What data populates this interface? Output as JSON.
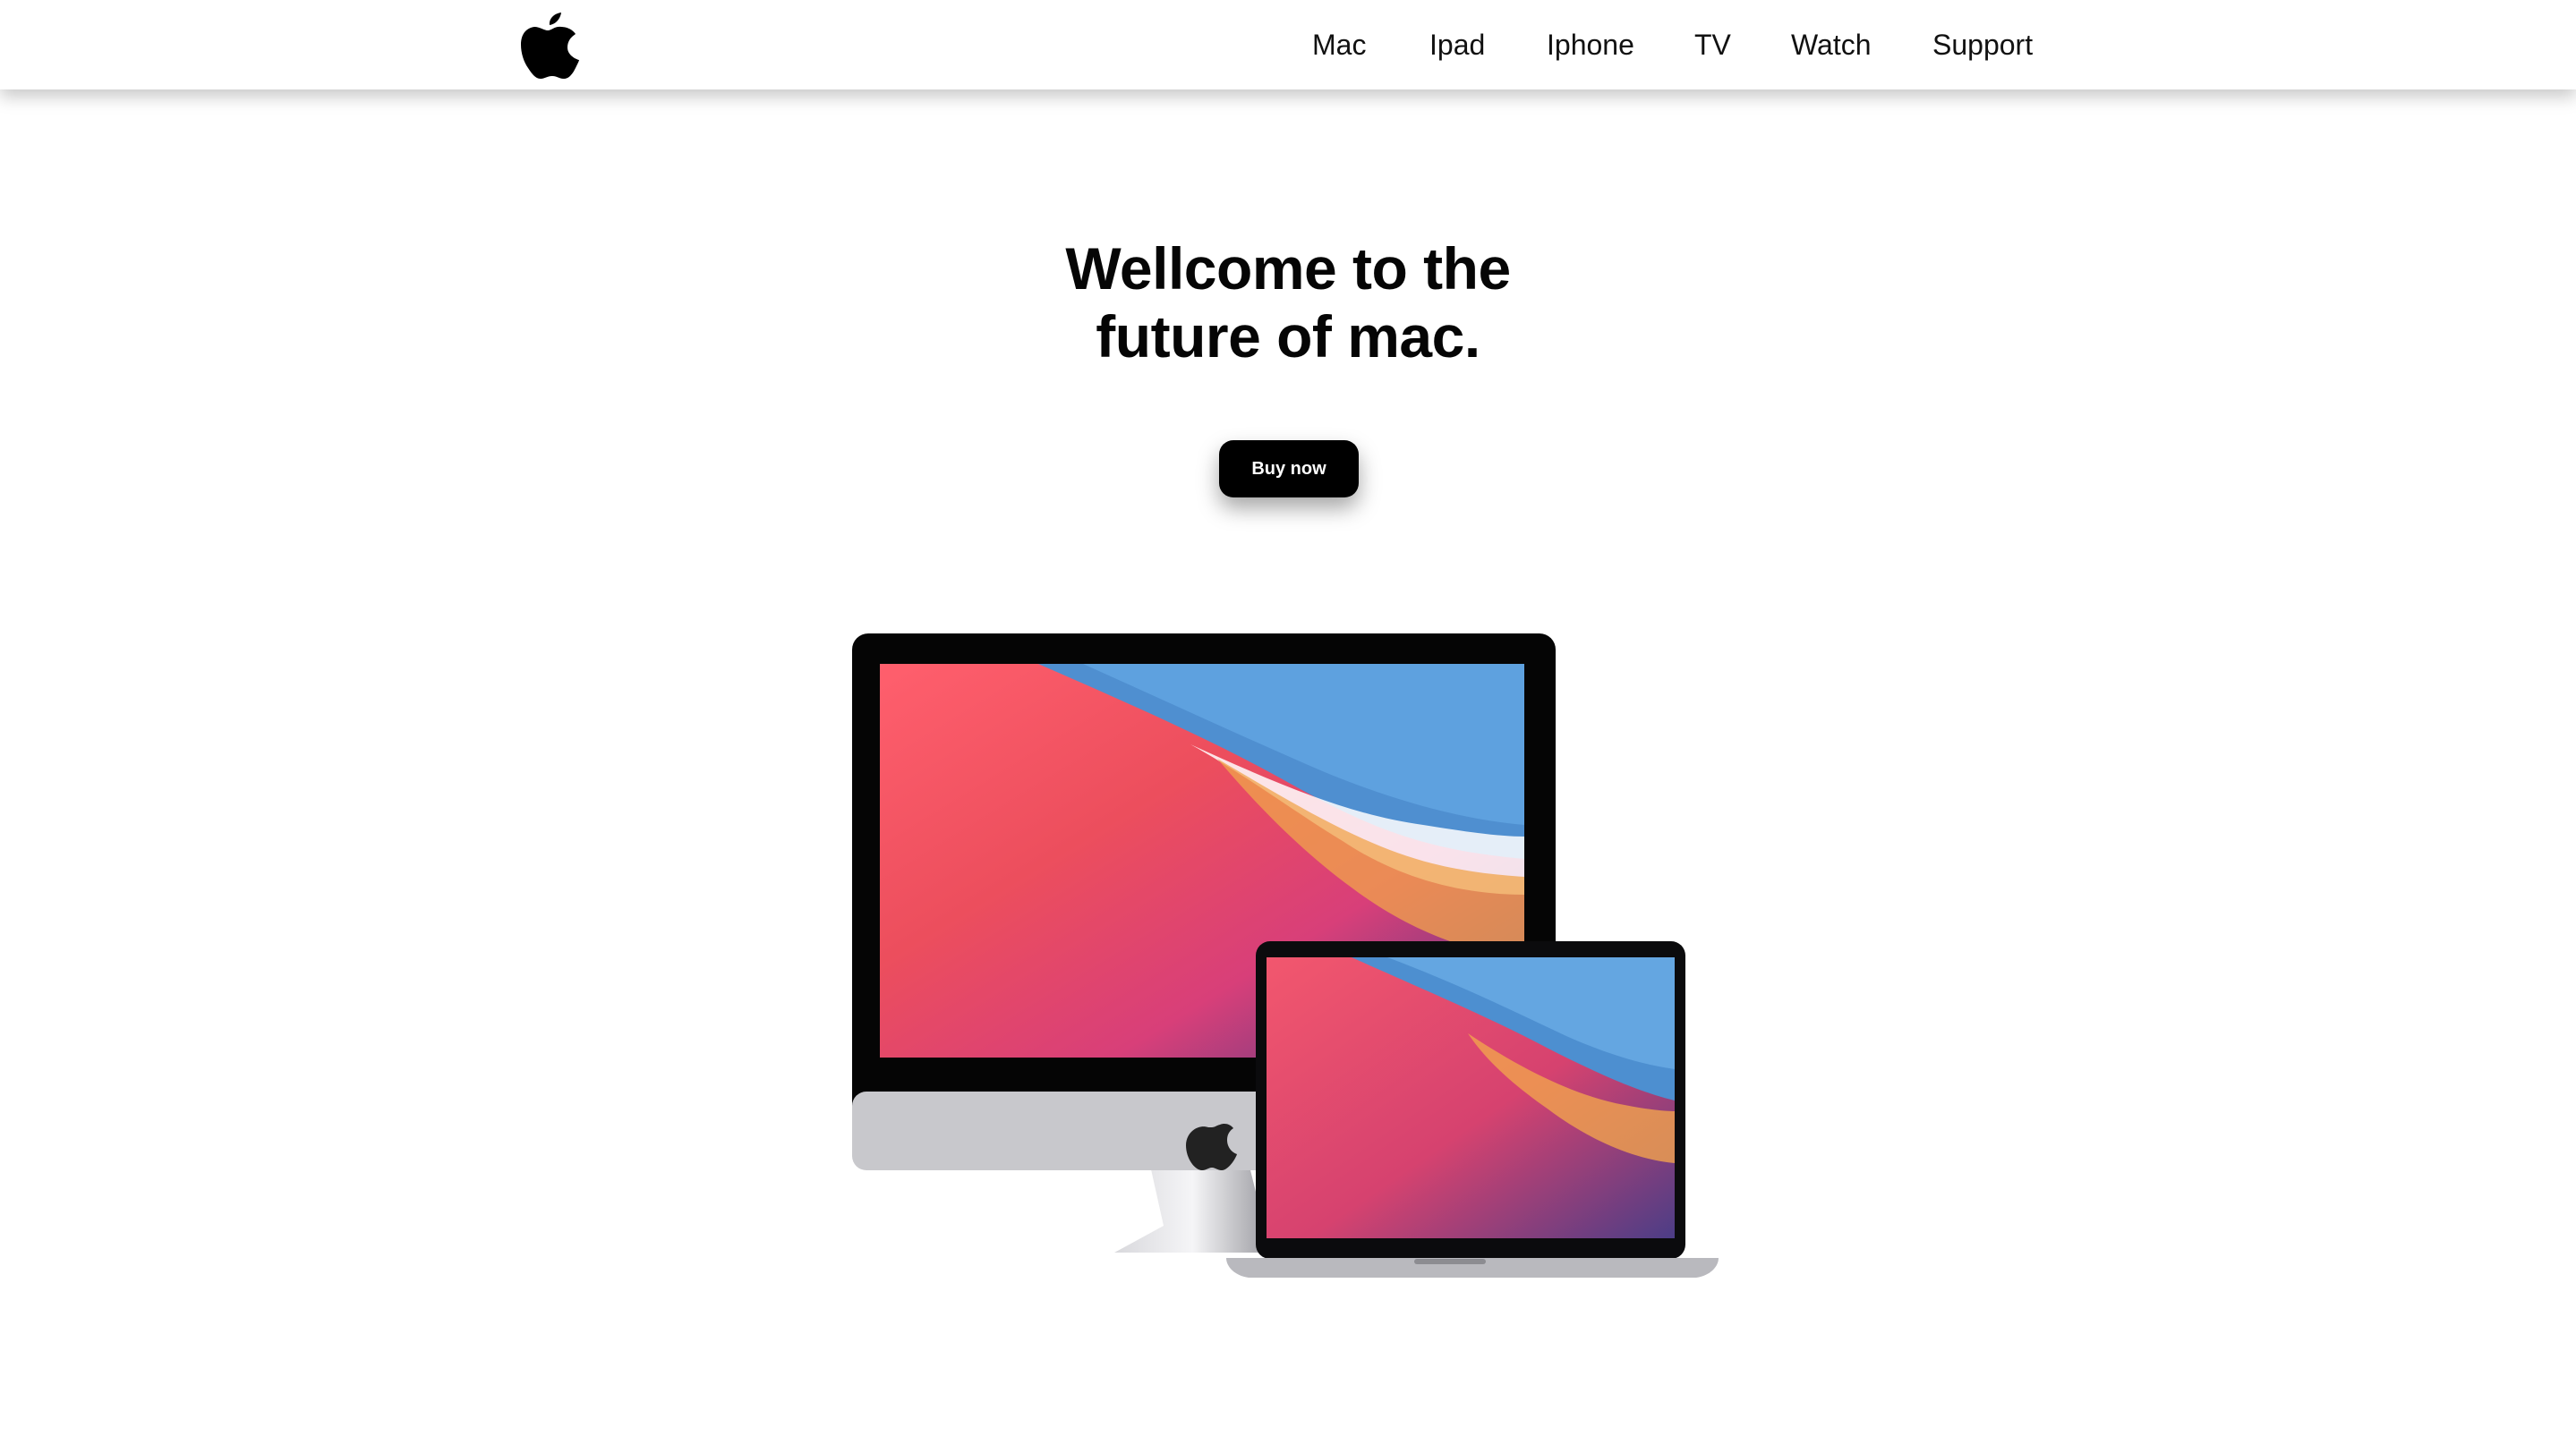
{
  "brand": {
    "logo_icon": "apple-logo-icon"
  },
  "nav": {
    "items": [
      {
        "label": "Mac"
      },
      {
        "label": "Ipad"
      },
      {
        "label": "Iphone"
      },
      {
        "label": "TV"
      },
      {
        "label": "Watch"
      },
      {
        "label": "Support"
      }
    ]
  },
  "hero": {
    "title_line1": "Wellcome to the",
    "title_line2": "future of mac.",
    "cta_label": "Buy now",
    "image_icon": "imac-and-macbook-illustration"
  },
  "colors": {
    "background": "#ffffff",
    "text": "#000000",
    "button_bg": "#000000",
    "button_text": "#ffffff"
  }
}
